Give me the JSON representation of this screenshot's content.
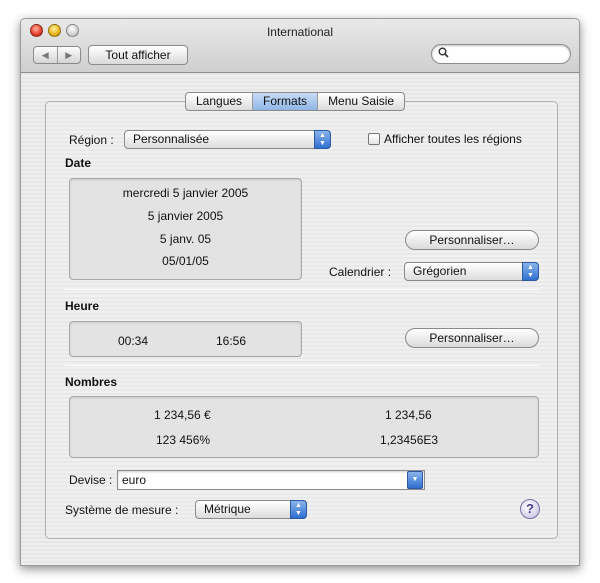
{
  "window": {
    "title": "International"
  },
  "toolbar": {
    "back_icon": "◀",
    "forward_icon": "▶",
    "show_all_label": "Tout afficher",
    "search_placeholder": ""
  },
  "tabs": [
    {
      "label": "Langues",
      "active": false
    },
    {
      "label": "Formats",
      "active": true
    },
    {
      "label": "Menu Saisie",
      "active": false
    }
  ],
  "region": {
    "label": "Région :",
    "value": "Personnalisée",
    "show_all_label": "Afficher toutes les régions",
    "show_all_checked": false
  },
  "date": {
    "heading": "Date",
    "samples": [
      "mercredi 5 janvier 2005",
      "5 janvier 2005",
      "5 janv. 05",
      "05/01/05"
    ],
    "customize_label": "Personnaliser…",
    "calendar_label": "Calendrier :",
    "calendar_value": "Grégorien"
  },
  "time": {
    "heading": "Heure",
    "samples": [
      "00:34",
      "16:56"
    ],
    "customize_label": "Personnaliser…"
  },
  "numbers": {
    "heading": "Nombres",
    "samples": [
      "1 234,56 €",
      "1 234,56",
      "123 456%",
      "1,23456E3"
    ]
  },
  "currency": {
    "label": "Devise :",
    "value": "euro"
  },
  "measure": {
    "label": "Système de mesure :",
    "value": "Métrique"
  },
  "help": {
    "glyph": "?"
  },
  "colors": {
    "accent": "#3a7bd5",
    "tab_active": "#a9c8ee"
  }
}
